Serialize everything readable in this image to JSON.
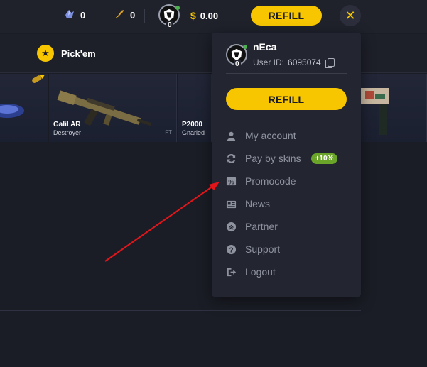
{
  "header": {
    "gems_count": "0",
    "rockets_count": "0",
    "rank_level": "0",
    "balance_symbol": "$",
    "balance": "0.00",
    "refill_label": "REFILL",
    "close_symbol": "✕"
  },
  "subnav": {
    "pickem_label": "Pick'em"
  },
  "cards": [
    {
      "name": "Galil AR",
      "sub": "Destroyer",
      "wear": "FT"
    },
    {
      "name": "P2000",
      "sub": "Gnarled",
      "wear": ""
    }
  ],
  "dropdown": {
    "username": "nEca",
    "user_id_label": "User ID:",
    "user_id": "6095074",
    "rank_level": "0",
    "refill_label": "REFILL",
    "menu": [
      {
        "label": "My account",
        "icon": "user-icon"
      },
      {
        "label": "Pay by skins",
        "icon": "exchange-icon",
        "badge": "+10%"
      },
      {
        "label": "Promocode",
        "icon": "percent-ticket-icon"
      },
      {
        "label": "News",
        "icon": "newspaper-icon"
      },
      {
        "label": "Partner",
        "icon": "partner-icon"
      },
      {
        "label": "Support",
        "icon": "question-icon"
      },
      {
        "label": "Logout",
        "icon": "logout-icon"
      }
    ]
  },
  "colors": {
    "accent": "#f7c600",
    "background": "#1b1d26",
    "dropdown_bg": "#232531",
    "badge_green": "#6aa52a",
    "arrow_red": "#e3151a"
  }
}
